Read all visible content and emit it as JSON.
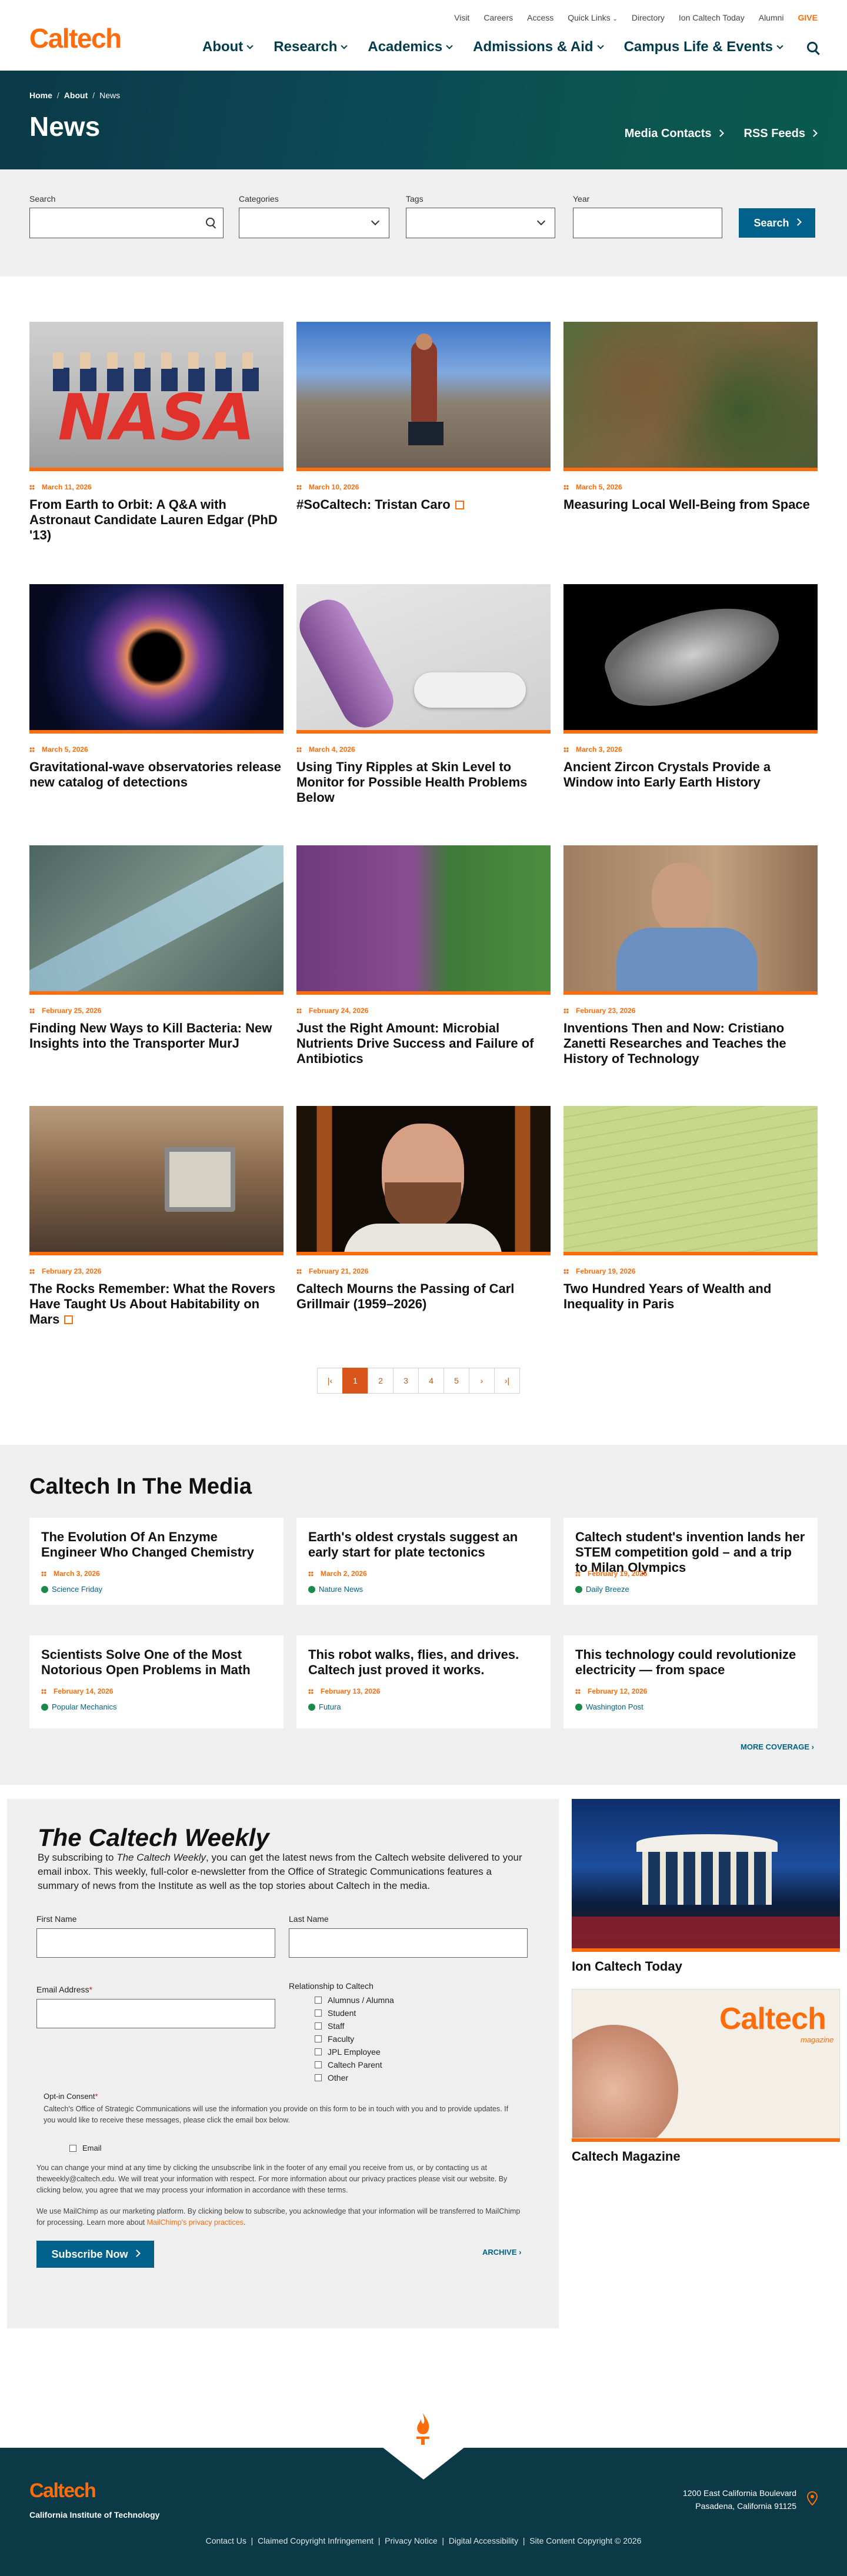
{
  "header": {
    "logo": "Caltech",
    "util_links": [
      "Visit",
      "Careers",
      "Access",
      "Quick Links",
      "Directory",
      "Ion Caltech Today",
      "Alumni"
    ],
    "give": "GIVE",
    "main_nav": [
      "About",
      "Research",
      "Academics",
      "Admissions & Aid",
      "Campus Life & Events"
    ]
  },
  "hero": {
    "breadcrumbs": [
      "Home",
      "About",
      "News"
    ],
    "title": "News",
    "links": [
      "Media Contacts",
      "RSS Feeds"
    ]
  },
  "filters": {
    "search_label": "Search",
    "categories_label": "Categories",
    "tags_label": "Tags",
    "year_label": "Year",
    "search_button": "Search"
  },
  "articles": [
    {
      "date": "March 11, 2026",
      "title": "From Earth to Orbit: A Q&A with Astronaut Candidate Lauren Edgar (PhD '13)",
      "image": "nasa-astronauts-photo"
    },
    {
      "date": "March 10, 2026",
      "title": "#SoCaltech: Tristan Caro",
      "image": "field-researcher-photo",
      "external": true
    },
    {
      "date": "March 5, 2026",
      "title": "Measuring Local Well-Being from Space",
      "image": "satellite-terrain-photo"
    },
    {
      "date": "March 5, 2026",
      "title": "Gravitational-wave observatories release new catalog of detections",
      "image": "black-hole-illustration"
    },
    {
      "date": "March 4, 2026",
      "title": "Using Tiny Ripples at Skin Level to Monitor for Possible Health Problems Below",
      "image": "foot-illustration"
    },
    {
      "date": "March 3, 2026",
      "title": "Ancient Zircon Crystals Provide a Window into Early Earth History",
      "image": "zircon-crystal-image"
    },
    {
      "date": "February 25, 2026",
      "title": "Finding New Ways to Kill Bacteria: New Insights into the Transporter MurJ",
      "image": "protein-structure-illustration"
    },
    {
      "date": "February 24, 2026",
      "title": "Just the Right Amount: Microbial Nutrients Drive Success and Failure of Antibiotics",
      "image": "microbe-fluorescence-image"
    },
    {
      "date": "February 23, 2026",
      "title": "Inventions Then and Now: Cristiano Zanetti Researches and Teaches the History of Technology",
      "image": "researcher-portrait"
    },
    {
      "date": "February 23, 2026",
      "title": "The Rocks Remember: What the Rovers Have Taught Us About Habitability on Mars",
      "image": "mars-rover-photo",
      "external": true
    },
    {
      "date": "February 21, 2026",
      "title": "Caltech Mourns the Passing of Carl Grillmair (1959–2026)",
      "image": "carl-grillmair-portrait"
    },
    {
      "date": "February 19, 2026",
      "title": "Two Hundred Years of Wealth and Inequality in Paris",
      "image": "historic-document-photo"
    }
  ],
  "pagination": {
    "first": "|‹",
    "prev": "‹",
    "pages": [
      "1",
      "2",
      "3",
      "4",
      "5"
    ],
    "next": "›",
    "last": "›|",
    "current": "1"
  },
  "media": {
    "title": "Caltech In The Media",
    "items": [
      {
        "title": "The Evolution Of An Enzyme Engineer Who Changed Chemistry",
        "date": "March 3, 2026",
        "source": "Science Friday"
      },
      {
        "title": "Earth's oldest crystals suggest an early start for plate tectonics",
        "date": "March 2, 2026",
        "source": "Nature News"
      },
      {
        "title": "Caltech student's invention lands her STEM competition gold – and a trip to Milan Olympics",
        "date": "February 19, 2026",
        "source": "Daily Breeze"
      },
      {
        "title": "Scientists Solve One of the Most Notorious Open Problems in Math",
        "date": "February 14, 2026",
        "source": "Popular Mechanics"
      },
      {
        "title": "This robot walks, flies, and drives. Caltech just proved it works.",
        "date": "February 13, 2026",
        "source": "Futura"
      },
      {
        "title": "This technology could revolutionize electricity — from space",
        "date": "February 12, 2026",
        "source": "Washington Post"
      }
    ],
    "more": "MORE COVERAGE ›"
  },
  "weekly": {
    "title": "The Caltech Weekly",
    "intro_pre": "By subscribing to ",
    "intro_em": "The Caltech Weekly",
    "intro_post": ", you can get the latest news from the Caltech website delivered to your email inbox. This weekly, full-color e-newsletter from the Office of Strategic Communications features a summary of news from the Institute as well as the top stories about Caltech in the media.",
    "first_name": "First Name",
    "last_name": "Last Name",
    "email": "Email Address",
    "relationship": "Relationship to Caltech",
    "options": [
      "Alumnus / Alumna",
      "Student",
      "Staff",
      "Faculty",
      "JPL Employee",
      "Caltech Parent",
      "Other"
    ],
    "optin_label": "Opt-in Consent",
    "optin_text": "Caltech's Office of Strategic Communications will use the information you provide on this form to be in touch with you and to provide updates. If you would like to receive these messages, please click the email box below.",
    "email_option": "Email",
    "privacy_text": "You can change your mind at any time by clicking the unsubscribe link in the footer of any email you receive from us, or by contacting us at theweekly@caltech.edu. We will treat your information with respect. For more information about our privacy practices please visit our website. By clicking below, you agree that we may process your information in accordance with these terms.",
    "mailchimp_pre": "We use MailChimp as our marketing platform. By clicking below to subscribe, you acknowledge that your information will be transferred to MailChimp for processing. Learn more about ",
    "mailchimp_link": "MailChimp's privacy practices",
    "mailchimp_post": ".",
    "subscribe": "Subscribe Now",
    "archive": "ARCHIVE ›"
  },
  "sidebar": {
    "ion_title": "Ion Caltech Today",
    "magazine_title": "Caltech Magazine",
    "magazine_logo": "Caltech",
    "magazine_sub": "magazine"
  },
  "footer": {
    "logo": "Caltech",
    "name": "California Institute of Technology",
    "address1": "1200 East California Boulevard",
    "address2": "Pasadena, California 91125",
    "links": [
      "Contact Us",
      "Claimed Copyright Infringement",
      "Privacy Notice",
      "Digital Accessibility",
      "Site Content Copyright © 2026"
    ]
  },
  "colors": {
    "orange": "#ff6c0c",
    "teal": "#0b3947",
    "link": "#00628a"
  }
}
